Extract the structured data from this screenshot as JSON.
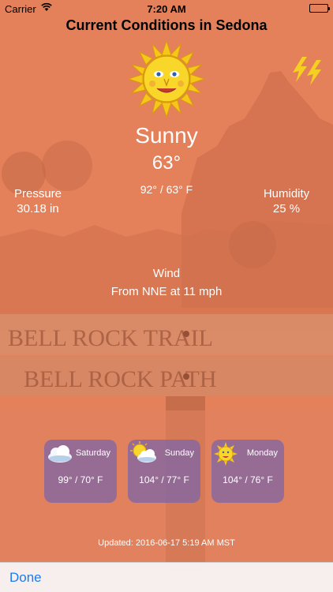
{
  "status_bar": {
    "carrier": "Carrier",
    "time": "7:20 AM"
  },
  "title": "Current Conditions in Sedona",
  "current": {
    "condition": "Sunny",
    "temperature": "63°",
    "high_low": "92° / 63° F",
    "condition_icon": "smiling-sun-icon"
  },
  "pressure": {
    "label": "Pressure",
    "value": "30.18 in"
  },
  "humidity": {
    "label": "Humidity",
    "value": "25 %"
  },
  "wind": {
    "label": "Wind",
    "value": "From NNE at 11 mph"
  },
  "forecast": [
    {
      "day": "Saturday",
      "range": "99° / 70° F",
      "icon": "cloudy-icon"
    },
    {
      "day": "Sunday",
      "range": "104° / 77° F",
      "icon": "partly-cloudy-icon"
    },
    {
      "day": "Monday",
      "range": "104° / 76° F",
      "icon": "sunny-icon"
    }
  ],
  "updated": "Updated: 2016-06-17 5:19 AM MST",
  "toolbar": {
    "done_label": "Done"
  },
  "colors": {
    "tint": "#e27b56",
    "card": "#7864aa",
    "done": "#1a7cf5",
    "refresh": "#f5d020"
  }
}
